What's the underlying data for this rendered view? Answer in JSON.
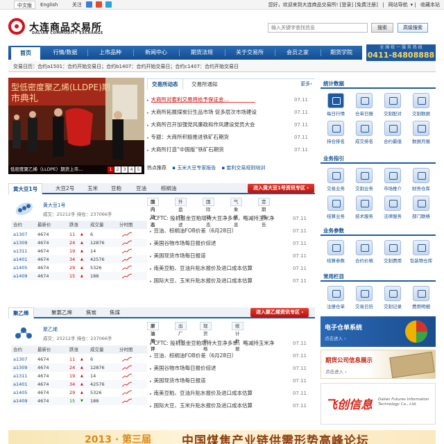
{
  "topbar": {
    "lang_cn": "中文版",
    "lang_en": "English",
    "follow": "关注",
    "welcome": "您好，欢迎来到大连商品交易所!",
    "login": "[登录]",
    "register": "[免费注册]",
    "site_nav": "网站导航",
    "favorite": "收藏本站"
  },
  "header": {
    "logo_cn": "大连商品交易所",
    "logo_en": "DALIAN COMMODITY EXCHANGE",
    "search_placeholder": "输入关键字查找信息",
    "search_btn": "搜索",
    "advanced_btn": "高级搜索"
  },
  "nav": {
    "items": [
      "首页",
      "行情/数据",
      "上市品种",
      "新闻中心",
      "期货法规",
      "关于交易所",
      "会员之家",
      "期货学院"
    ],
    "hotline_l1": "全 国 统 一 服 务 热 线",
    "hotline_l2": "0411-84808888"
  },
  "subbar": "交易日历：合约a1501：合约开始交易日；合约b1407：合约开始交易日；合约c1407：合约开始交易日",
  "banner": {
    "caption": "低密度聚乙烯（LLDPE）期货上市...",
    "pages": [
      "1",
      "2",
      "3",
      "4",
      "5"
    ],
    "sign_text": "型低密度聚乙烯(LLDPE)期",
    "sign_text2": "市典礼"
  },
  "news": {
    "tab1": "交易所动态",
    "tab2": "交易所通知",
    "more": "更多›",
    "items": [
      {
        "title": "大商所对套利交易将给予保证金...",
        "date": "07.11"
      },
      {
        "title": "大商所拓展煤炭衍生品市场  促多层次市场建设",
        "date": "07.11"
      },
      {
        "title": "大商所召开加强党风廉政和作风建设党员大会",
        "date": "07.11"
      },
      {
        "title": "专题：大商所积极推进铁矿石期货",
        "date": "07.11"
      },
      {
        "title": "大商所打造“中国版”铁矿石期货",
        "date": "07.11"
      }
    ],
    "hot_label": "热点推荐",
    "hot1": "▪ 玉米大豆专家报告",
    "hot2": "▪ 套利交易规则培训"
  },
  "panel1": {
    "tabs": [
      "黄大豆1号",
      "大豆2号",
      "玉米",
      "豆粕",
      "豆油",
      "棕榈油"
    ],
    "enter": "进入黄大豆1号资讯专区 ›",
    "name": "黄大豆1号",
    "stats": "成交：25212手    持仓：237066手",
    "subtabs": [
      "国内动态",
      "外盘评述",
      "国际动态",
      "气象信息",
      "定期报告"
    ],
    "cols": [
      "合约",
      "最新价",
      "跌涨",
      "成交量",
      "分时图"
    ],
    "rows": [
      {
        "c": "a1307",
        "p": "4674",
        "d": "11",
        "dir": "up",
        "v": "6"
      },
      {
        "c": "a1309",
        "p": "4674",
        "d": "24",
        "dir": "up",
        "v": "12876"
      },
      {
        "c": "a1311",
        "p": "4674",
        "d": "19",
        "dir": "up",
        "v": "14"
      },
      {
        "c": "a1401",
        "p": "4674",
        "d": "34",
        "dir": "up",
        "v": "42576"
      },
      {
        "c": "a1405",
        "p": "4674",
        "d": "29",
        "dir": "up",
        "v": "5326"
      },
      {
        "c": "a1409",
        "p": "4674",
        "d": "15",
        "dir": "up",
        "v": "188"
      }
    ],
    "news": [
      {
        "title": "CFTC: 投机基金豆粕增持大豆净多单，略减持玉米净",
        "date": "07.11"
      },
      {
        "title": "豆油、棕榈油FOB价差（6月28日）",
        "date": "07.11"
      },
      {
        "title": "美国谷物市场每日报价综述",
        "date": "07.11"
      },
      {
        "title": "美国现货市场每日报道",
        "date": "07.11"
      },
      {
        "title": "南美豆粕、豆油升贴水报价及进口成本估算",
        "date": "07.11"
      },
      {
        "title": "国际大豆、玉米升贴水报价及进口成本估算",
        "date": "07.11"
      }
    ]
  },
  "panel2": {
    "tabs": [
      "聚乙烯",
      "聚氯乙烯",
      "焦炭",
      "焦煤"
    ],
    "enter": "进入聚乙烯资讯专区 ›",
    "name": "聚乙烯",
    "stats": "成交：25212手    持仓：237066手",
    "subtabs": [
      "原油简评",
      "出厂价",
      "现货价格",
      "统计数据"
    ],
    "cols": [
      "合约",
      "最新价",
      "跌涨",
      "成交量",
      "分时图"
    ],
    "rows": [
      {
        "c": "a1307",
        "p": "4674",
        "d": "11",
        "dir": "up",
        "v": "6"
      },
      {
        "c": "a1309",
        "p": "4674",
        "d": "24",
        "dir": "up",
        "v": "12876"
      },
      {
        "c": "a1311",
        "p": "4674",
        "d": "19",
        "dir": "up",
        "v": "14"
      },
      {
        "c": "a1401",
        "p": "4674",
        "d": "34",
        "dir": "up",
        "v": "42576"
      },
      {
        "c": "a1405",
        "p": "4674",
        "d": "29",
        "dir": "up",
        "v": "5326"
      },
      {
        "c": "a1409",
        "p": "4674",
        "d": "15",
        "dir": "down",
        "v": "188"
      }
    ],
    "news": [
      {
        "title": "CFTC: 投机基金豆粕增持大豆净多单，略减持玉米净",
        "date": "07.11"
      },
      {
        "title": "豆油、棕榈油FOB价差（6月28日）",
        "date": "07.11"
      },
      {
        "title": "美国谷物市场每日报价综述",
        "date": "07.11"
      },
      {
        "title": "美国现货市场每日报道",
        "date": "07.11"
      },
      {
        "title": "南美豆粕、豆油升贴水报价及进口成本估算",
        "date": "07.11"
      },
      {
        "title": "国际大豆、玉米升贴水报价及进口成本估算",
        "date": "07.11"
      }
    ]
  },
  "sidebar": {
    "stats_title": "统计数据",
    "stats": [
      "每日行情",
      "仓单日报",
      "交割配对",
      "交割数据",
      "持仓排名",
      "成交排名",
      "合约最值",
      "数据月报"
    ],
    "biz_title": "业务指引",
    "biz": [
      "交易业务",
      "交割业务",
      "市场推介",
      "财务仓库",
      "结算业务",
      "技术服务",
      "法律服务",
      "部门联络"
    ],
    "params_title": "业务参数",
    "params": [
      "结算参数",
      "合约价格",
      "交割费用",
      "包装物仓库"
    ],
    "common_title": "常用栏目",
    "common": [
      "注册仓单",
      "交易日历",
      "交割记录",
      "费用明细"
    ],
    "ad1_title": "电子仓单系统",
    "ad1_sub": "点击进入 ›",
    "ad2_title": "期货公司信息展示",
    "ad2_sub": "点击进入 ›",
    "ad3_cn": "飞创信息",
    "ad3_en": "Dalian Futures Information Technology Co., Ltd."
  },
  "footer_banner": {
    "year": "2013 · 第三届",
    "text": "中国煤焦产业链供需形势高峰论坛"
  }
}
